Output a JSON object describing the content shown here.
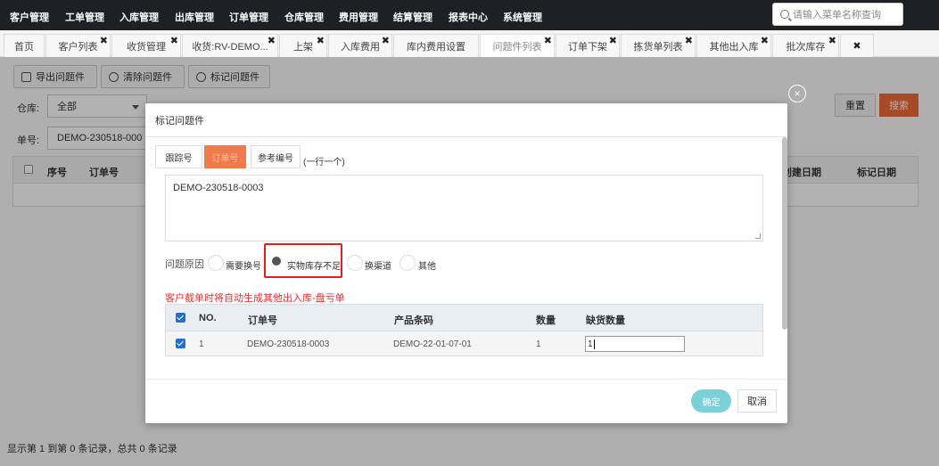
{
  "topnav": {
    "items": [
      "客户管理",
      "工单管理",
      "入库管理",
      "出库管理",
      "订单管理",
      "仓库管理",
      "费用管理",
      "结算管理",
      "报表中心",
      "系统管理"
    ],
    "search_placeholder": "请输入菜单名称查询"
  },
  "tabs": [
    {
      "label": "首页"
    },
    {
      "label": "客户列表"
    },
    {
      "label": "收货管理"
    },
    {
      "label": "收货:RV-DEMO..."
    },
    {
      "label": "上架"
    },
    {
      "label": "入库费用"
    },
    {
      "label": "库内费用设置"
    },
    {
      "label": "问题件列表"
    },
    {
      "label": "订单下架"
    },
    {
      "label": "拣货单列表"
    },
    {
      "label": "其他出入库"
    },
    {
      "label": "批次库存"
    }
  ],
  "tab_close_glyph": "✖",
  "toolbar": {
    "export_label": "导出问题件",
    "clear_label": "清除问题件",
    "mark_label": "标记问题件"
  },
  "filters": {
    "warehouse_label": "仓库:",
    "warehouse_value": "全部",
    "order_label": "单号:",
    "order_value": "DEMO-230518-000",
    "reset_label": "重置",
    "search_label": "搜索"
  },
  "bg_table": {
    "columns": [
      "序号",
      "订单号",
      "创建日期",
      "标记日期"
    ]
  },
  "footer": "显示第 1 到第 0 条记录，总共 0 条记录",
  "modal": {
    "title": "标记问题件",
    "close_glyph": "×",
    "tabs": [
      "跟踪号",
      "订单号",
      "参考编号"
    ],
    "hint": "(一行一个)",
    "textarea_value": "DEMO-230518-0003",
    "reason_label": "问题原因",
    "reasons": [
      "需要换号",
      "实物库存不足",
      "换渠道",
      "其他"
    ],
    "warning": "客户截单时将自动生成其他出入库-盘亏单",
    "table": {
      "headers": [
        "NO.",
        "订单号",
        "产品条码",
        "数量",
        "缺货数量"
      ],
      "rows": [
        {
          "no": "1",
          "order": "DEMO-230518-0003",
          "barcode": "DEMO-22-01-07-01",
          "qty": "1",
          "short_qty": "1"
        }
      ]
    },
    "ok_label": "确定",
    "cancel_label": "取消"
  },
  "colors": {
    "nav_bg": "#1e2024",
    "accent_orange": "#ee6b3a",
    "ok_button": "#7cd1d8",
    "highlight_red": "#e02020",
    "warning_red": "#e03030",
    "checkbox_blue": "#1f6fd6"
  },
  "icons": [
    "search-icon",
    "export-icon",
    "clear-user-icon",
    "mark-forbid-icon",
    "close-icon",
    "checkbox-checked-icon",
    "radio-icon"
  ]
}
